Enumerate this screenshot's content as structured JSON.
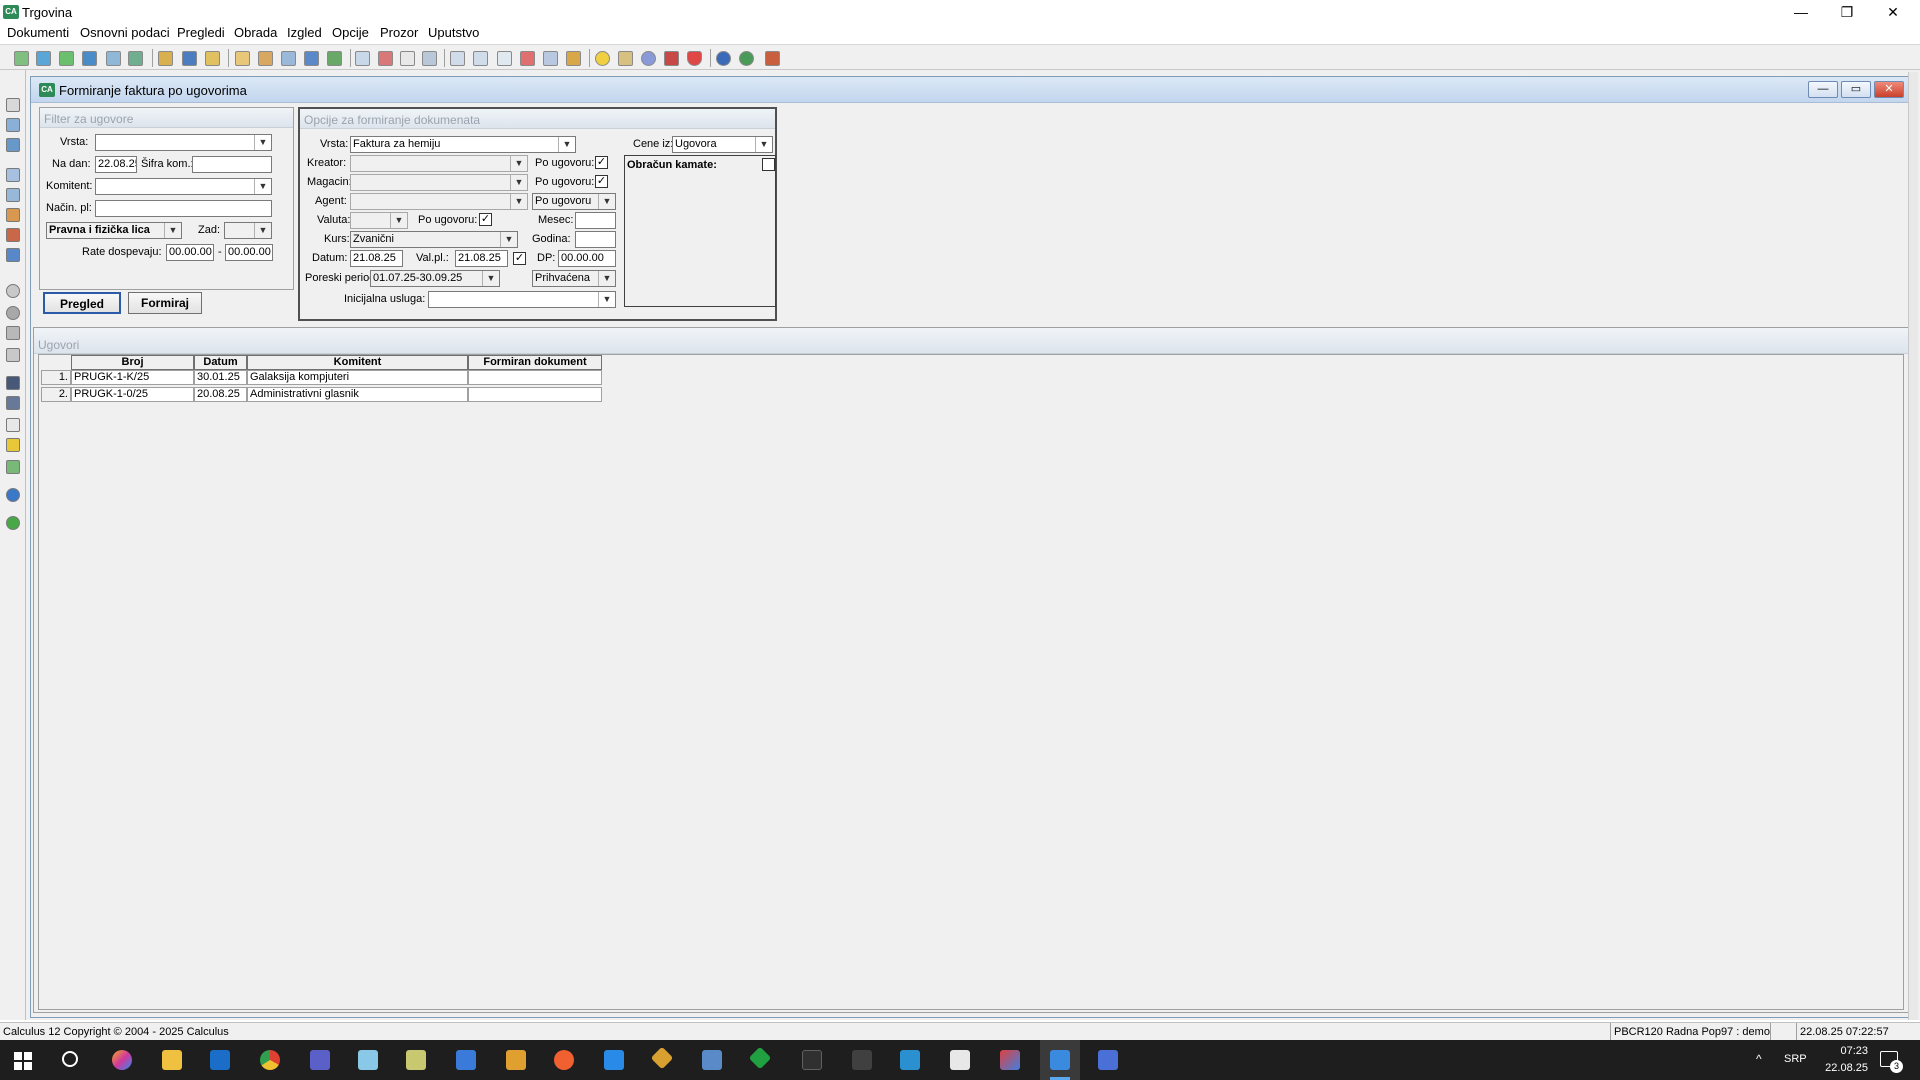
{
  "app": {
    "title": "Trgovina",
    "icon_text": "CA"
  },
  "menu": [
    "Dokumenti",
    "Osnovni podaci",
    "Pregledi",
    "Obrada",
    "Izgled",
    "Opcije",
    "Prozor",
    "Uputstvo"
  ],
  "window_controls": {
    "minimize": "—",
    "restore": "❐",
    "close": "✕"
  },
  "child": {
    "title": "Formiranje faktura po ugovorima",
    "controls": {
      "minimize": "—",
      "restore": "▭",
      "close": "✕"
    }
  },
  "filter": {
    "title": "Filter za ugovore",
    "vrsta_label": "Vrsta:",
    "vrsta_value": "",
    "na_dan_label": "Na dan:",
    "na_dan_value": "22.08.25",
    "sifra_label": "Šifra kom.:",
    "sifra_value": "",
    "komitent_label": "Komitent:",
    "komitent_value": "",
    "nacin_label": "Način. pl:",
    "nacin_value": "",
    "lica_value": "Pravna i fizička lica",
    "zad_label": "Zad:",
    "zad_value": "",
    "rate_label": "Rate dospevaju:",
    "rate_from": "00.00.00",
    "rate_sep": "-",
    "rate_to": "00.00.00"
  },
  "buttons": {
    "pregled": "Pregled",
    "formiraj": "Formiraj"
  },
  "options": {
    "title": "Opcije za formiranje dokumenata",
    "vrsta_label": "Vrsta:",
    "vrsta_value": "Faktura za hemiju",
    "cene_label": "Cene iz:",
    "cene_value": "Ugovora",
    "kreator_label": "Kreator:",
    "kreator_value": "",
    "po_ugovoru_label": "Po ugovoru:",
    "magacin_label": "Magacin:",
    "magacin_value": "",
    "agent_label": "Agent:",
    "agent_value": "",
    "agent_sel": "Po ugovoru",
    "valuta_label": "Valuta:",
    "valuta_value": "",
    "mesec_label": "Mesec:",
    "mesec_value": "",
    "kurs_label": "Kurs:",
    "kurs_value": "Zvanični",
    "godina_label": "Godina:",
    "godina_value": "",
    "datum_label": "Datum:",
    "datum_value": "21.08.25",
    "valpl_label": "Val.pl.:",
    "valpl_value": "21.08.25",
    "dp_label": "DP:",
    "dp_value": "00.00.00",
    "poreski_label": "Poreski period:",
    "poreski_value": "01.07.25-30.09.25",
    "prihvacena_value": "Prihvaćena",
    "inicijalna_label": "Inicijalna usluga:",
    "inicijalna_value": "",
    "obracun_label": "Obračun kamate:",
    "check_mark": "✓"
  },
  "contracts": {
    "title": "Ugovori",
    "columns": [
      "Broj",
      "Datum",
      "Komitent",
      "Formiran dokument"
    ],
    "rows": [
      {
        "n": "1.",
        "broj": "PRUGK-1-K/25",
        "datum": "30.01.25",
        "komitent": "Galaksija kompjuteri",
        "dokument": ""
      },
      {
        "n": "2.",
        "broj": "PRUGK-1-0/25",
        "datum": "20.08.25",
        "komitent": "Administrativni glasnik",
        "dokument": ""
      }
    ]
  },
  "statusbar": {
    "left": "Calculus 12  Copyright © 2004 - 2025  Calculus",
    "db": "PBCR120 Radna Pop97 : demo",
    "time": "22.08.25 07:22:57"
  },
  "taskbar": {
    "lang": "SRP",
    "clock_time": "07:23",
    "clock_date": "22.08.25",
    "notif_count": "3",
    "tray_up": "^"
  },
  "colors": {
    "accent": "#2e8b57",
    "taskbar": "#1e1e1e"
  }
}
